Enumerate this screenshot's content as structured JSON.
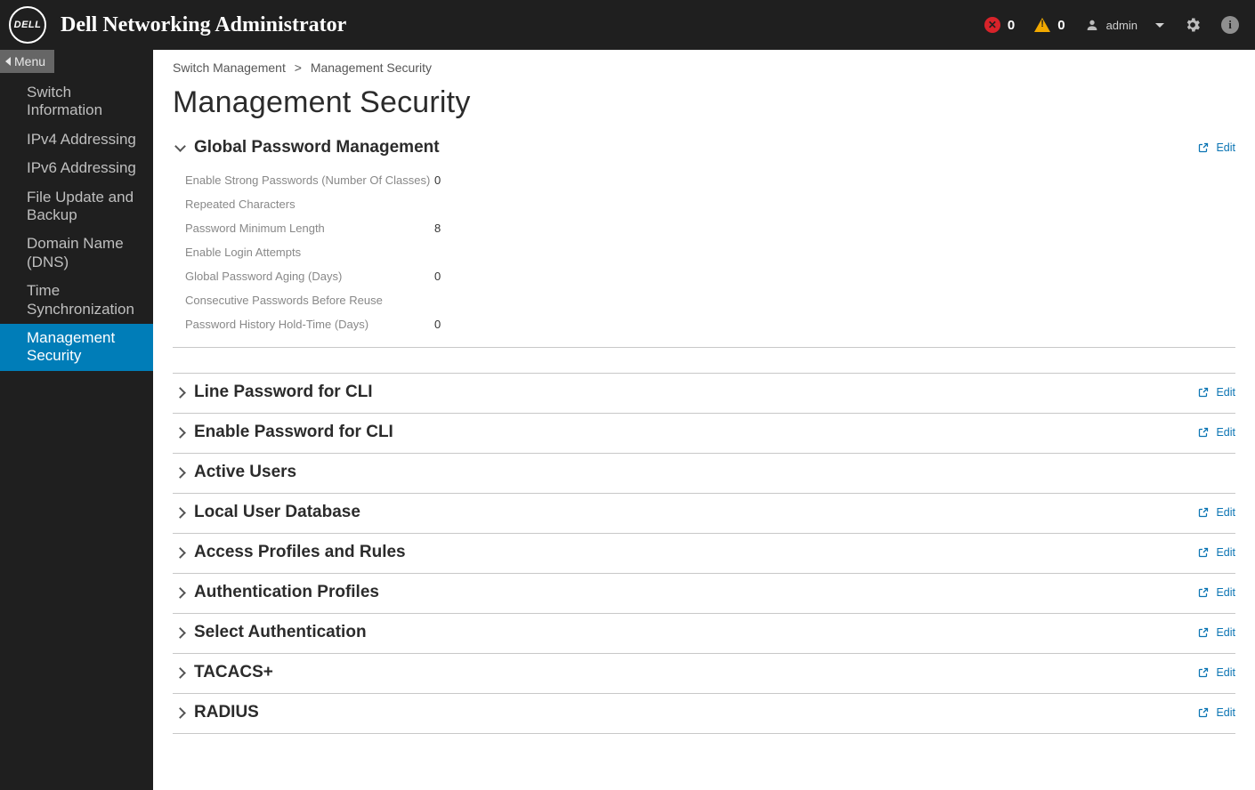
{
  "header": {
    "logo_text": "DELL",
    "app_title": "Dell Networking Administrator",
    "error_count": "0",
    "warning_count": "0",
    "username": "admin"
  },
  "sidebar": {
    "menu_label": "Menu",
    "items": [
      {
        "label": "Switch Information"
      },
      {
        "label": "IPv4 Addressing"
      },
      {
        "label": "IPv6 Addressing"
      },
      {
        "label": "File Update and Backup"
      },
      {
        "label": "Domain Name (DNS)"
      },
      {
        "label": "Time Synchronization"
      },
      {
        "label": "Management Security"
      }
    ]
  },
  "breadcrumb": {
    "root": "Switch Management",
    "leaf": "Management Security"
  },
  "page": {
    "title": "Management Security"
  },
  "actions": {
    "edit": "Edit"
  },
  "sections": [
    {
      "title": "Global Password Management",
      "expanded": true,
      "has_edit": true,
      "fields": [
        {
          "label": "Enable Strong Passwords (Number Of Classes)",
          "value": "0"
        },
        {
          "label": "Repeated Characters",
          "value": ""
        },
        {
          "label": "Password Minimum Length",
          "value": "8"
        },
        {
          "label": "Enable Login Attempts",
          "value": ""
        },
        {
          "label": "Global Password Aging (Days)",
          "value": "0"
        },
        {
          "label": "Consecutive Passwords Before Reuse",
          "value": ""
        },
        {
          "label": "Password History Hold-Time (Days)",
          "value": "0"
        }
      ]
    },
    {
      "title": "Line Password for CLI",
      "expanded": false,
      "has_edit": true
    },
    {
      "title": "Enable Password for CLI",
      "expanded": false,
      "has_edit": true
    },
    {
      "title": "Active Users",
      "expanded": false,
      "has_edit": false
    },
    {
      "title": "Local User Database",
      "expanded": false,
      "has_edit": true
    },
    {
      "title": "Access Profiles and Rules",
      "expanded": false,
      "has_edit": true
    },
    {
      "title": "Authentication Profiles",
      "expanded": false,
      "has_edit": true
    },
    {
      "title": "Select Authentication",
      "expanded": false,
      "has_edit": true
    },
    {
      "title": "TACACS+",
      "expanded": false,
      "has_edit": true
    },
    {
      "title": "RADIUS",
      "expanded": false,
      "has_edit": true
    }
  ]
}
